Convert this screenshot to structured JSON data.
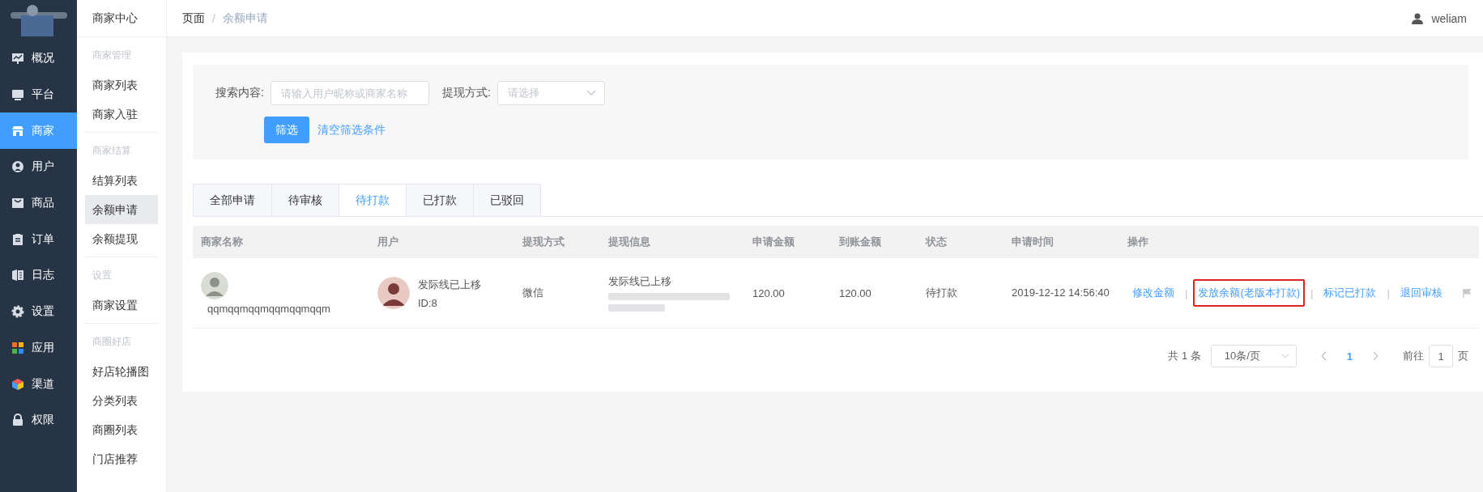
{
  "nav": [
    {
      "label": "概况",
      "selected": false
    },
    {
      "label": "平台",
      "selected": false
    },
    {
      "label": "商家",
      "selected": true
    },
    {
      "label": "用户",
      "selected": false
    },
    {
      "label": "商品",
      "selected": false
    },
    {
      "label": "订单",
      "selected": false
    },
    {
      "label": "日志",
      "selected": false
    },
    {
      "label": "设置",
      "selected": false
    },
    {
      "label": "应用",
      "selected": false
    },
    {
      "label": "渠道",
      "selected": false
    },
    {
      "label": "权限",
      "selected": false
    }
  ],
  "subnav": {
    "title": "商家中心",
    "groups": [
      {
        "title": "商家管理",
        "items": [
          {
            "label": "商家列表",
            "selected": false
          },
          {
            "label": "商家入驻",
            "selected": false
          }
        ]
      },
      {
        "title": "商家结算",
        "items": [
          {
            "label": "结算列表",
            "selected": false
          },
          {
            "label": "余额申请",
            "selected": true
          },
          {
            "label": "余额提现",
            "selected": false
          }
        ]
      },
      {
        "title": "设置",
        "items": [
          {
            "label": "商家设置",
            "selected": false
          }
        ]
      },
      {
        "title": "商圈好店",
        "items": [
          {
            "label": "好店轮播图",
            "selected": false
          },
          {
            "label": "分类列表",
            "selected": false
          },
          {
            "label": "商圈列表",
            "selected": false
          },
          {
            "label": "门店推荐",
            "selected": false
          }
        ]
      }
    ]
  },
  "breadcrumb": {
    "items": [
      "页面",
      "余额申请"
    ],
    "separator": "/"
  },
  "user": "weliam",
  "filter": {
    "fields": [
      {
        "kind": "input",
        "label": "搜索内容:",
        "placeholder": "请输入用户昵称或商家名称"
      },
      {
        "kind": "select",
        "label": "提现方式:",
        "placeholder": "请选择"
      }
    ],
    "submit": "筛选",
    "clear": "清空筛选条件"
  },
  "tabs": [
    {
      "label": "全部申请",
      "selected": false
    },
    {
      "label": "待审核",
      "selected": false
    },
    {
      "label": "待打款",
      "selected": true
    },
    {
      "label": "已打款",
      "selected": false
    },
    {
      "label": "已驳回",
      "selected": false
    }
  ],
  "table": {
    "columns": [
      "商家名称",
      "用户",
      "提现方式",
      "提现信息",
      "申请金额",
      "到账金额",
      "状态",
      "申请时间",
      "操作"
    ],
    "rows": [
      {
        "merchant": "qqmqqmqqmqqmqqmqqm",
        "user_name": "发际线已上移",
        "user_id": "ID:8",
        "method": "微信",
        "info": "发际线已上移",
        "amount": "120.00",
        "received": "120.00",
        "status": "待打款",
        "time": "2019-12-12 14:56:40",
        "actions": [
          {
            "label": "修改金额",
            "highlighted": false
          },
          {
            "label": "发放余额(老版本打款)",
            "highlighted": true
          },
          {
            "label": "标记已打款",
            "highlighted": false
          },
          {
            "label": "退回审核",
            "highlighted": false
          }
        ]
      }
    ],
    "action_separator": "|"
  },
  "pagination": {
    "total": "共 1 条",
    "page_size": "10条/页",
    "pages": [
      {
        "label": "1",
        "selected": true
      }
    ],
    "goto_label": "前往",
    "goto_value": "1",
    "goto_suffix": "页"
  }
}
